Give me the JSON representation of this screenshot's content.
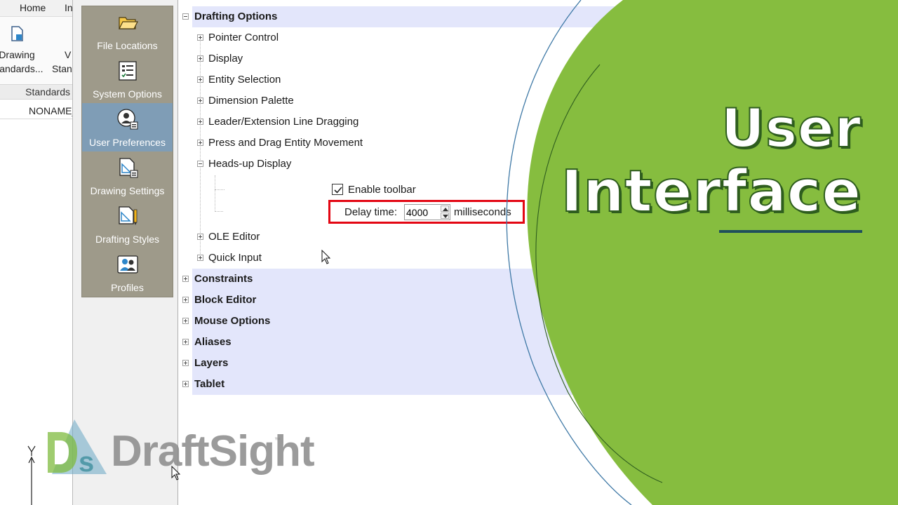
{
  "background_app": {
    "ribbon_tabs": [
      "Home",
      "In"
    ],
    "ribbon_buttons": [
      {
        "line1": "Drawing",
        "line2": "Standards...",
        "icon": "document-icon"
      },
      {
        "line1": "V",
        "line2": "Stan",
        "icon": "document-icon"
      }
    ],
    "group_label": "Standards",
    "document_tab": "NONAME_"
  },
  "dialog": {
    "nav_items": [
      {
        "label": "File Locations",
        "icon": "folder-icon"
      },
      {
        "label": "System Options",
        "icon": "checklist-icon"
      },
      {
        "label": "User Preferences",
        "icon": "user-preferences-icon"
      },
      {
        "label": "Drawing Settings",
        "icon": "drawing-settings-icon"
      },
      {
        "label": "Drafting Styles",
        "icon": "drafting-styles-icon"
      },
      {
        "label": "Profiles",
        "icon": "profiles-icon"
      }
    ],
    "active_nav": "User Preferences",
    "tree": {
      "drafting_options": {
        "label": "Drafting Options",
        "children": [
          "Pointer Control",
          "Display",
          "Entity Selection",
          "Dimension Palette",
          "Leader/Extension Line Dragging",
          "Press and Drag Entity Movement",
          "Heads-up Display",
          "OLE Editor",
          "Quick Input"
        ]
      },
      "heads_up": {
        "enable_toolbar_label": "Enable toolbar",
        "enable_toolbar_checked": true,
        "delay_label": "Delay time:",
        "delay_value": "4000",
        "delay_unit": "milliseconds"
      },
      "categories": [
        "Constraints",
        "Block Editor",
        "Mouse Options",
        "Aliases",
        "Layers",
        "Tablet"
      ]
    }
  },
  "overlay": {
    "title_line1": "User",
    "title_line2": "Interface",
    "accent_green": "#86bd3f",
    "underline_color": "#1f4f5c"
  },
  "logo": {
    "text": "DraftSight",
    "mark": "DS",
    "tm": "™"
  }
}
